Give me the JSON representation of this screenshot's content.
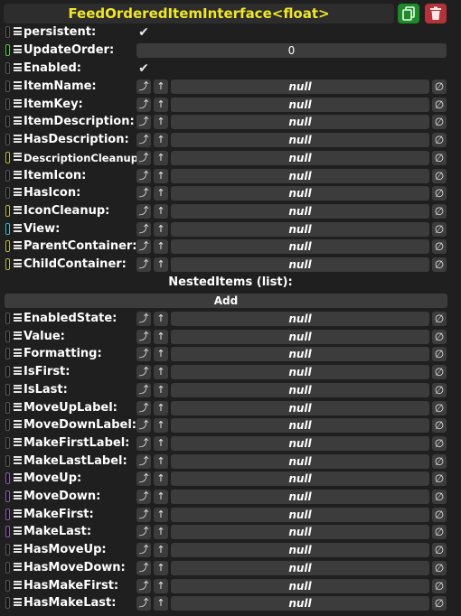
{
  "header": {
    "title": "FeedOrderedItemInterface<float>",
    "copy_icon": "copy-icon",
    "delete_icon": "trash-icon",
    "copy_color": "#1d8a2a",
    "delete_color": "#b3333a"
  },
  "fields": {
    "persistent": {
      "label": "persistent:",
      "checked": true
    },
    "update_order": {
      "label": "UpdateOrder:",
      "value": "0"
    },
    "enabled": {
      "label": "Enabled:",
      "checked": true
    }
  },
  "ref_fields_top": [
    {
      "label": "ItemName:",
      "value": "null",
      "driver": "default"
    },
    {
      "label": "ItemKey:",
      "value": "null",
      "driver": "default"
    },
    {
      "label": "ItemDescription:",
      "value": "null",
      "driver": "default"
    },
    {
      "label": "HasDescription:",
      "value": "null",
      "driver": "default"
    },
    {
      "label": "DescriptionCleanup:",
      "value": "null",
      "driver": "olive"
    },
    {
      "label": "ItemIcon:",
      "value": "null",
      "driver": "default"
    },
    {
      "label": "HasIcon:",
      "value": "null",
      "driver": "default"
    },
    {
      "label": "IconCleanup:",
      "value": "null",
      "driver": "olive"
    },
    {
      "label": "View:",
      "value": "null",
      "driver": "teal"
    },
    {
      "label": "ParentContainer:",
      "value": "null",
      "driver": "olive"
    },
    {
      "label": "ChildContainer:",
      "value": "null",
      "driver": "olive"
    }
  ],
  "nested": {
    "header": "NestedItems (list):",
    "add_label": "Add"
  },
  "ref_fields_bottom": [
    {
      "label": "EnabledState:",
      "value": "null",
      "driver": "default"
    },
    {
      "label": "Value:",
      "value": "null",
      "driver": "default"
    },
    {
      "label": "Formatting:",
      "value": "null",
      "driver": "default"
    },
    {
      "label": "IsFirst:",
      "value": "null",
      "driver": "default"
    },
    {
      "label": "IsLast:",
      "value": "null",
      "driver": "default"
    },
    {
      "label": "MoveUpLabel:",
      "value": "null",
      "driver": "default"
    },
    {
      "label": "MoveDownLabel:",
      "value": "null",
      "driver": "default"
    },
    {
      "label": "MakeFirstLabel:",
      "value": "null",
      "driver": "default"
    },
    {
      "label": "MakeLastLabel:",
      "value": "null",
      "driver": "default"
    },
    {
      "label": "MoveUp:",
      "value": "null",
      "driver": "purple"
    },
    {
      "label": "MoveDown:",
      "value": "null",
      "driver": "purple"
    },
    {
      "label": "MakeFirst:",
      "value": "null",
      "driver": "purple"
    },
    {
      "label": "MakeLast:",
      "value": "null",
      "driver": "purple"
    },
    {
      "label": "HasMoveUp:",
      "value": "null",
      "driver": "default"
    },
    {
      "label": "HasMoveDown:",
      "value": "null",
      "driver": "default"
    },
    {
      "label": "HasMakeFirst:",
      "value": "null",
      "driver": "default"
    },
    {
      "label": "HasMakeLast:",
      "value": "null",
      "driver": "default"
    }
  ],
  "button_glyphs": {
    "jump": "⤴",
    "up": "↑",
    "null": "∅",
    "check": "✔"
  }
}
